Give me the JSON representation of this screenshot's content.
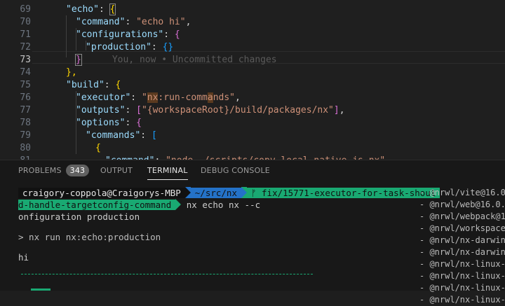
{
  "editor": {
    "lines": [
      {
        "n": "69",
        "segments": [
          {
            "t": "\"echo\"",
            "c": "k"
          },
          {
            "t": ": ",
            "c": "p"
          },
          {
            "t": "{",
            "c": "b1"
          }
        ]
      },
      {
        "n": "70",
        "segments": [
          {
            "t": "\"command\"",
            "c": "k"
          },
          {
            "t": ": ",
            "c": "p"
          },
          {
            "t": "\"echo hi\"",
            "c": "s"
          },
          {
            "t": ",",
            "c": "p"
          }
        ]
      },
      {
        "n": "71",
        "segments": [
          {
            "t": "\"configurations\"",
            "c": "k"
          },
          {
            "t": ": ",
            "c": "p"
          },
          {
            "t": "{",
            "c": "b2"
          }
        ]
      },
      {
        "n": "72",
        "segments": [
          {
            "t": "\"production\"",
            "c": "k"
          },
          {
            "t": ": ",
            "c": "p"
          },
          {
            "t": "{}",
            "c": "b3"
          }
        ]
      },
      {
        "n": "73",
        "segments": [
          {
            "t": "}",
            "c": "b2"
          }
        ]
      },
      {
        "n": "74",
        "segments": [
          {
            "t": "},",
            "c": "b1"
          }
        ]
      },
      {
        "n": "75",
        "segments": [
          {
            "t": "\"build\"",
            "c": "k"
          },
          {
            "t": ": ",
            "c": "p"
          },
          {
            "t": "{",
            "c": "b1"
          }
        ]
      },
      {
        "n": "76",
        "segments": [
          {
            "t": "\"executor\"",
            "c": "k"
          },
          {
            "t": ": ",
            "c": "p"
          },
          {
            "t": "\"nx:run-commands\"",
            "c": "s"
          },
          {
            "t": ",",
            "c": "p"
          }
        ]
      },
      {
        "n": "77",
        "segments": [
          {
            "t": "\"outputs\"",
            "c": "k"
          },
          {
            "t": ": ",
            "c": "p"
          },
          {
            "t": "[",
            "c": "b2"
          },
          {
            "t": "\"{workspaceRoot}/build/packages/nx\"",
            "c": "s"
          },
          {
            "t": "]",
            "c": "b2"
          },
          {
            "t": ",",
            "c": "p"
          }
        ]
      },
      {
        "n": "78",
        "segments": [
          {
            "t": "\"options\"",
            "c": "k"
          },
          {
            "t": ": ",
            "c": "p"
          },
          {
            "t": "{",
            "c": "b2"
          }
        ]
      },
      {
        "n": "79",
        "segments": [
          {
            "t": "\"commands\"",
            "c": "k"
          },
          {
            "t": ": ",
            "c": "p"
          },
          {
            "t": "[",
            "c": "b3"
          }
        ]
      },
      {
        "n": "80",
        "segments": [
          {
            "t": "{",
            "c": "b1"
          }
        ]
      },
      {
        "n": "81",
        "segments": [
          {
            "t": "\"command\"",
            "c": "k"
          },
          {
            "t": ": ",
            "c": "p"
          },
          {
            "t": "\"node ./scripts/copy-local-native.js nx\"",
            "c": "s"
          }
        ]
      }
    ],
    "blame": "You, now • Uncommitted changes"
  },
  "panel": {
    "tabs": [
      {
        "label": "PROBLEMS",
        "badge": "343"
      },
      {
        "label": "OUTPUT"
      },
      {
        "label": "TERMINAL"
      },
      {
        "label": "DEBUG CONSOLE"
      }
    ]
  },
  "terminal": {
    "prompt_user": "craigory-coppola@Craigorys-MBP",
    "prompt_path": "~/src/nx",
    "branch_line1": "ᚠ fix/15771-executor-for-task-shoul",
    "branch_line2": "d-handle-targetconfig-command",
    "command": "nx echo nx --c",
    "wrap": "onfiguration production",
    "run_line": "> nx run nx:echo:production",
    "output": "hi"
  },
  "right_list": [
    "- @nrwl/vite@16.0.",
    "- @nrwl/web@16.0.1",
    "- @nrwl/webpack@16",
    "- @nrwl/workspace@",
    "- @nrwl/nx-darwin-",
    "- @nrwl/nx-darwin-",
    "- @nrwl/nx-linux-a",
    "- @nrwl/nx-linux-a",
    "- @nrwl/nx-linux-a",
    "- @nrwl/nx-linux-x"
  ]
}
